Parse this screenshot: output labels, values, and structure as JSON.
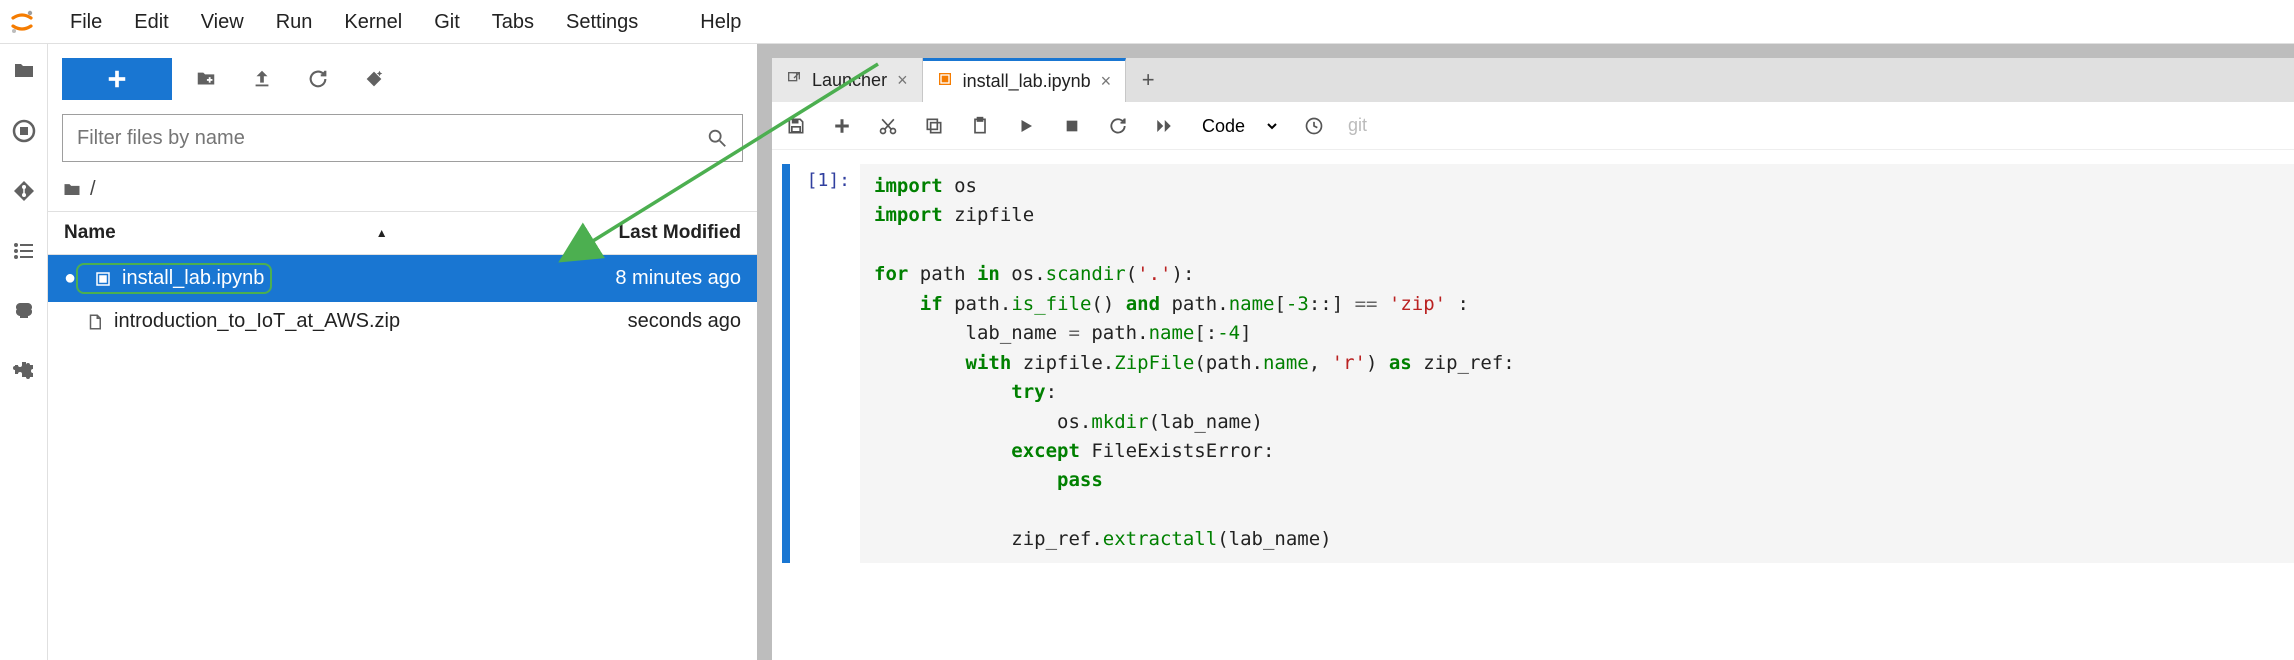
{
  "menu": [
    "File",
    "Edit",
    "View",
    "Run",
    "Kernel",
    "Git",
    "Tabs",
    "Settings",
    "Help"
  ],
  "filebrowser": {
    "filter_placeholder": "Filter files by name",
    "breadcrumb_root": "/",
    "columns": {
      "name": "Name",
      "modified": "Last Modified"
    },
    "files": [
      {
        "name": "install_lab.ipynb",
        "modified": "8 minutes ago",
        "selected": true,
        "running": true,
        "kind": "notebook"
      },
      {
        "name": "introduction_to_IoT_at_AWS.zip",
        "modified": "seconds ago",
        "selected": false,
        "running": false,
        "kind": "file"
      }
    ]
  },
  "tabs": [
    {
      "label": "Launcher",
      "icon": "external-link-icon",
      "active": false
    },
    {
      "label": "install_lab.ipynb",
      "icon": "notebook-icon",
      "active": true
    }
  ],
  "notebook_toolbar": {
    "cell_type": "Code",
    "git_label": "git"
  },
  "cell": {
    "prompt": "[1]:",
    "code_tokens": [
      {
        "t": "import ",
        "c": "k"
      },
      {
        "t": "os\n"
      },
      {
        "t": "import ",
        "c": "k"
      },
      {
        "t": "zipfile\n\n"
      },
      {
        "t": "for ",
        "c": "k"
      },
      {
        "t": "path "
      },
      {
        "t": "in ",
        "c": "k"
      },
      {
        "t": "os"
      },
      {
        "t": "."
      },
      {
        "t": "scandir",
        "c": "m"
      },
      {
        "t": "("
      },
      {
        "t": "'.'",
        "c": "s"
      },
      {
        "t": "):\n"
      },
      {
        "t": "    "
      },
      {
        "t": "if ",
        "c": "k"
      },
      {
        "t": "path"
      },
      {
        "t": "."
      },
      {
        "t": "is_file",
        "c": "m"
      },
      {
        "t": "() "
      },
      {
        "t": "and ",
        "c": "k"
      },
      {
        "t": "path"
      },
      {
        "t": "."
      },
      {
        "t": "name",
        "c": "m"
      },
      {
        "t": "["
      },
      {
        "t": "-3",
        "c": "m"
      },
      {
        "t": "::] "
      },
      {
        "t": "== ",
        "c": "op"
      },
      {
        "t": "'zip'",
        "c": "s"
      },
      {
        "t": " :\n"
      },
      {
        "t": "        lab_name "
      },
      {
        "t": "= ",
        "c": "op"
      },
      {
        "t": "path"
      },
      {
        "t": "."
      },
      {
        "t": "name",
        "c": "m"
      },
      {
        "t": "[:"
      },
      {
        "t": "-4",
        "c": "m"
      },
      {
        "t": "]\n"
      },
      {
        "t": "        "
      },
      {
        "t": "with ",
        "c": "k"
      },
      {
        "t": "zipfile"
      },
      {
        "t": "."
      },
      {
        "t": "ZipFile",
        "c": "m"
      },
      {
        "t": "(path"
      },
      {
        "t": "."
      },
      {
        "t": "name",
        "c": "m"
      },
      {
        "t": ", "
      },
      {
        "t": "'r'",
        "c": "s"
      },
      {
        "t": ") "
      },
      {
        "t": "as ",
        "c": "k"
      },
      {
        "t": "zip_ref:\n"
      },
      {
        "t": "            "
      },
      {
        "t": "try",
        "c": "k"
      },
      {
        "t": ":\n"
      },
      {
        "t": "                os"
      },
      {
        "t": "."
      },
      {
        "t": "mkdir",
        "c": "m"
      },
      {
        "t": "(lab_name)\n"
      },
      {
        "t": "            "
      },
      {
        "t": "except ",
        "c": "k"
      },
      {
        "t": "FileExistsError:\n"
      },
      {
        "t": "                "
      },
      {
        "t": "pass",
        "c": "k"
      },
      {
        "t": "\n\n"
      },
      {
        "t": "            zip_ref"
      },
      {
        "t": "."
      },
      {
        "t": "extractall",
        "c": "m"
      },
      {
        "t": "(lab_name)"
      }
    ]
  }
}
